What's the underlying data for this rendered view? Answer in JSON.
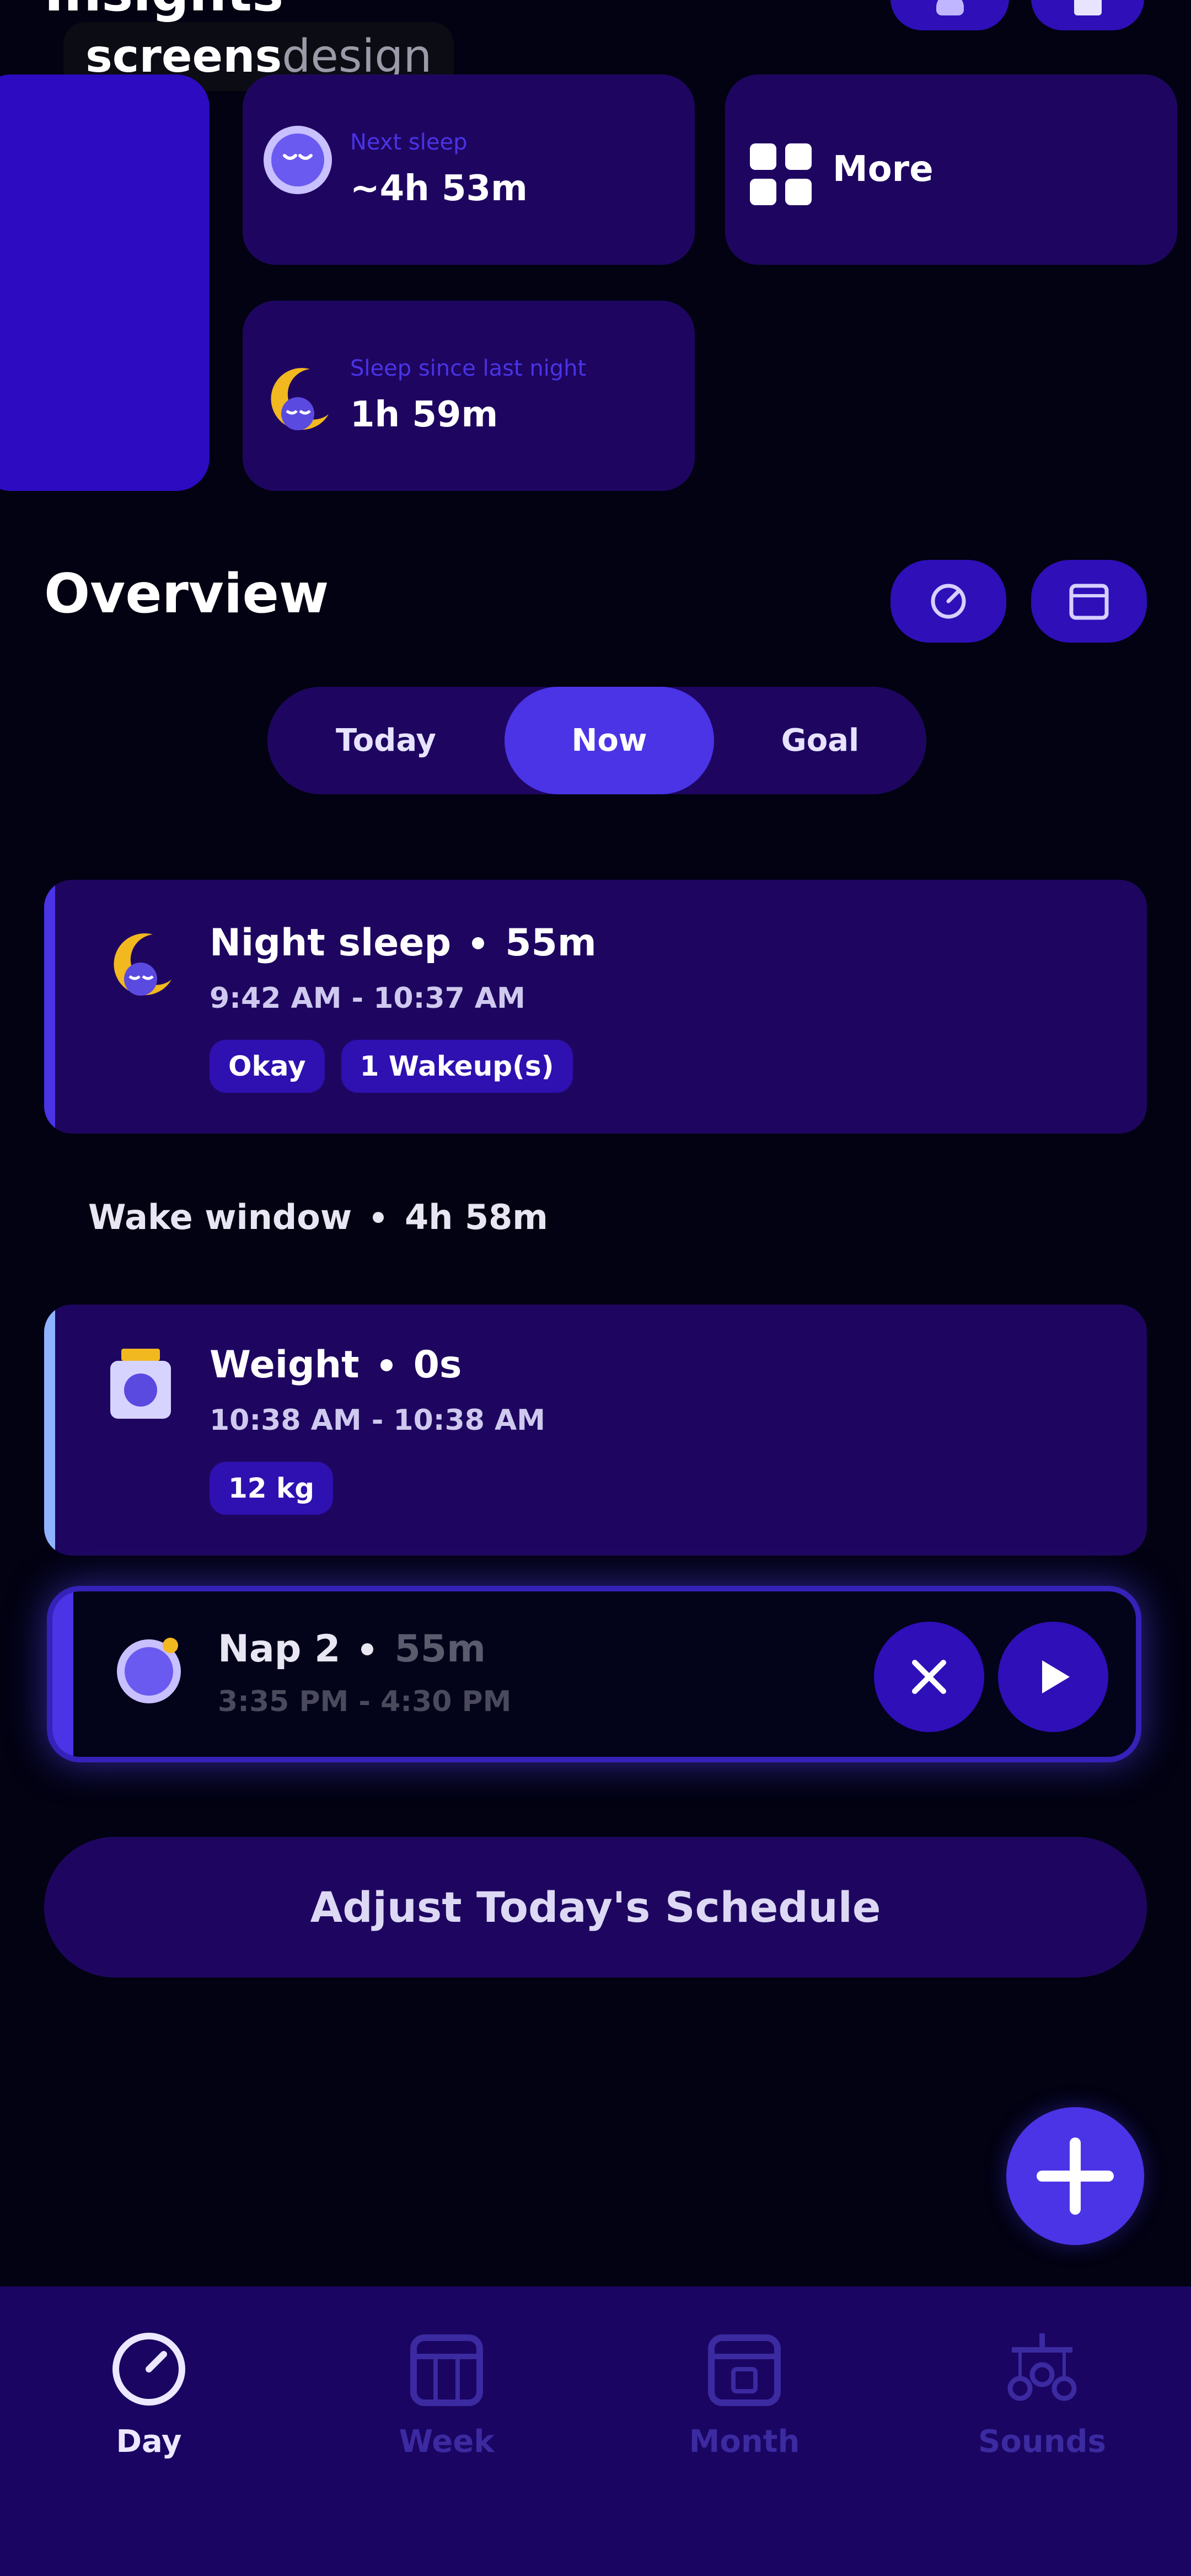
{
  "header": {
    "title_partial": "Insights",
    "watermark_bold": "screens",
    "watermark_light": "design"
  },
  "top_cards": {
    "next_sleep": {
      "label": "Next sleep",
      "value": "~4h 53m"
    },
    "more": {
      "label": "More"
    },
    "sleep_since": {
      "label": "Sleep since last night",
      "value": "1h 59m"
    }
  },
  "overview": {
    "title": "Overview",
    "tabs": [
      "Today",
      "Now",
      "Goal"
    ],
    "active_tab": "Now"
  },
  "entries": {
    "night_sleep": {
      "title": "Night sleep",
      "duration": "55m",
      "time": "9:42 AM - 10:37 AM",
      "tags": [
        "Okay",
        "1 Wakeup(s)"
      ]
    },
    "wake_window": {
      "label": "Wake window",
      "duration": "4h 58m"
    },
    "weight": {
      "title": "Weight",
      "duration": "0s",
      "time": "10:38 AM - 10:38 AM",
      "tags": [
        "12 kg"
      ]
    },
    "nap": {
      "title": "Nap 2",
      "duration": "55m",
      "time": "3:35 PM - 4:30 PM"
    }
  },
  "adjust_button": {
    "label": "Adjust Today's Schedule"
  },
  "bottom_nav": {
    "items": [
      {
        "label": "Day",
        "icon": "timer-icon",
        "active": true
      },
      {
        "label": "Week",
        "icon": "week-calendar-icon",
        "active": false
      },
      {
        "label": "Month",
        "icon": "month-calendar-icon",
        "active": false
      },
      {
        "label": "Sounds",
        "icon": "mobile-icon",
        "active": false
      }
    ]
  },
  "colors": {
    "background": "#020212",
    "card": "#1e0660",
    "accent": "#4a34e6",
    "nav_bg": "#1a0562",
    "moon": "#f2b820"
  }
}
